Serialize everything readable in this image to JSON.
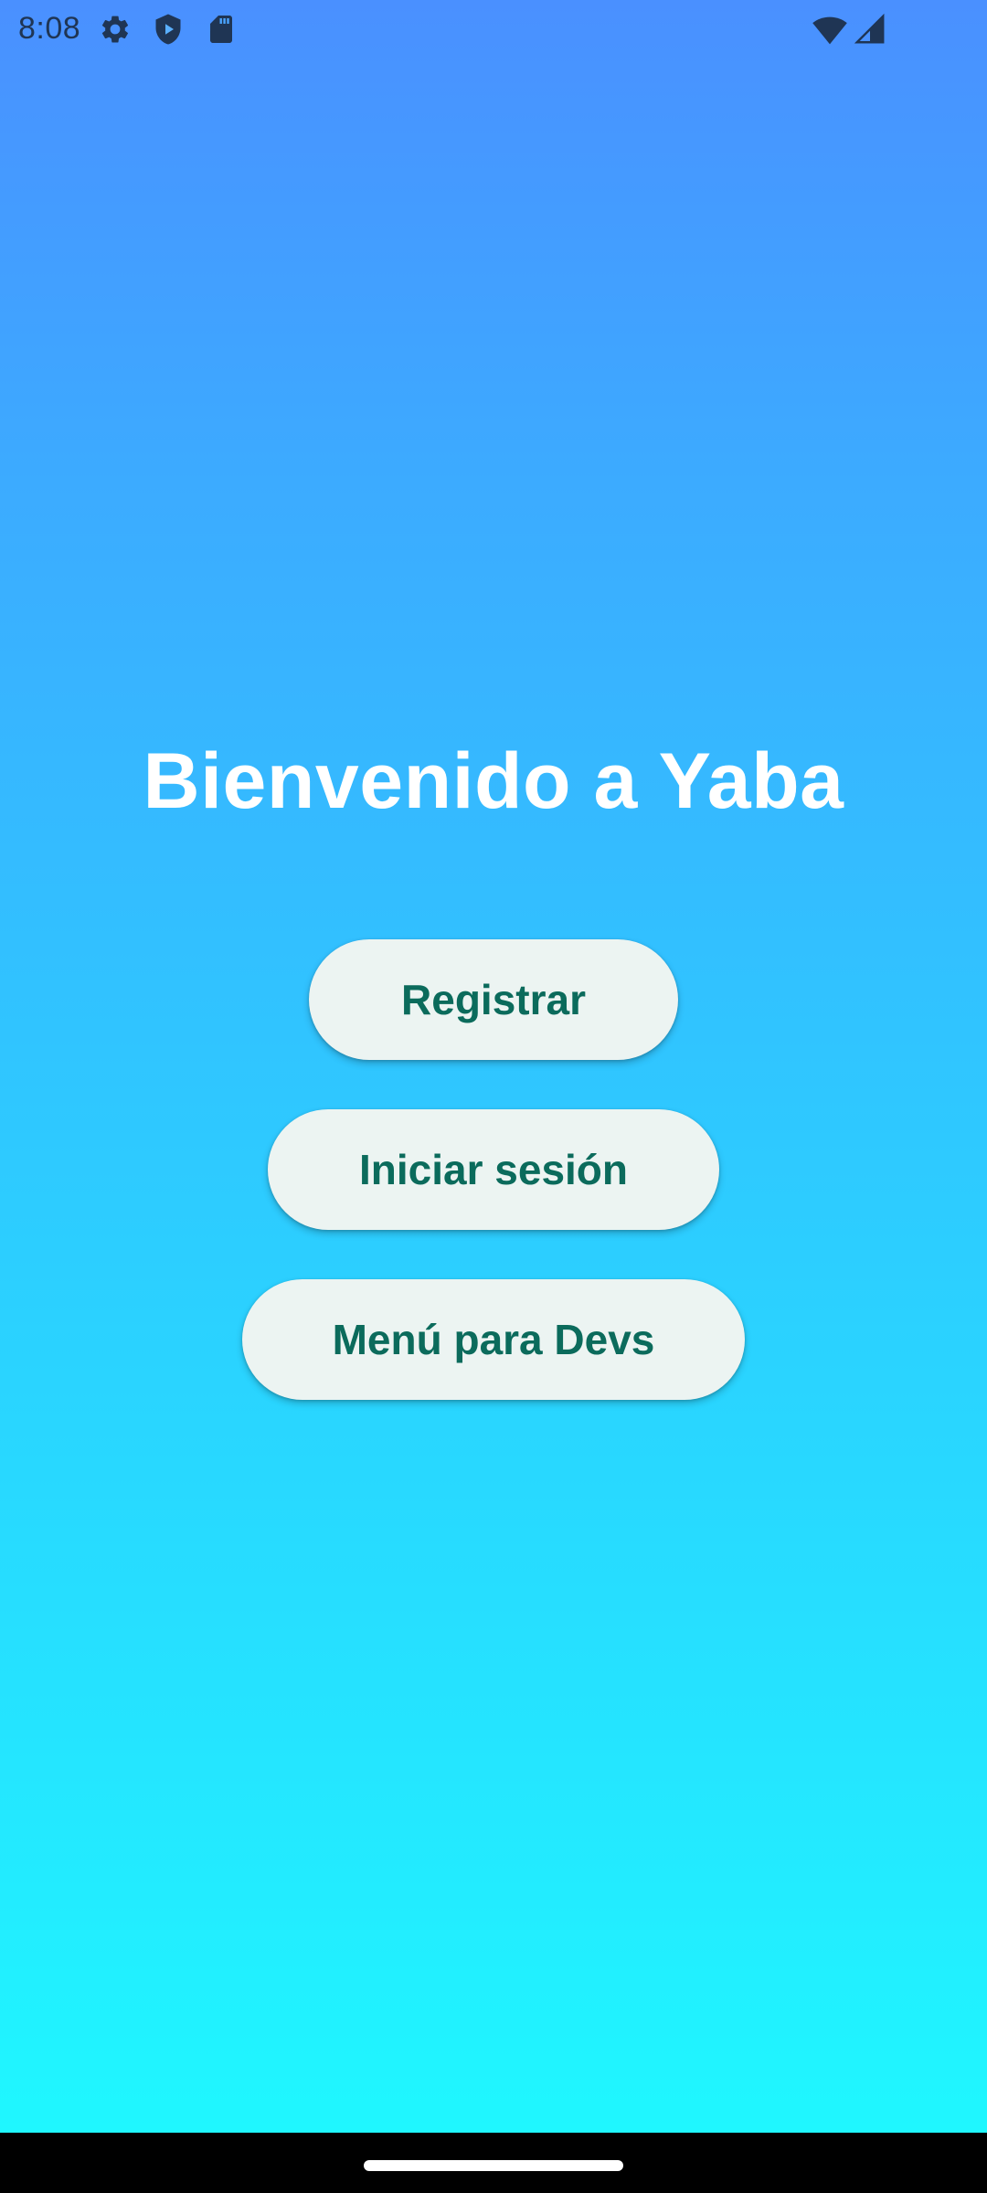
{
  "status_bar": {
    "time": "8:08",
    "icons_left": [
      "gear-icon",
      "shield-play-icon",
      "sd-card-icon"
    ],
    "icons_right": [
      "wifi-icon",
      "cell-signal-icon"
    ]
  },
  "welcome": {
    "title": "Bienvenido a Yaba"
  },
  "buttons": {
    "register": "Registrar",
    "login": "Iniciar sesión",
    "dev_menu": "Menú para Devs"
  },
  "colors": {
    "gradient_top": "#4a90ff",
    "gradient_bottom": "#1efaff",
    "button_bg": "#ecf4f2",
    "button_text": "#0b6b5c",
    "title_text": "#ffffff",
    "status_icons": "#1f3554"
  }
}
